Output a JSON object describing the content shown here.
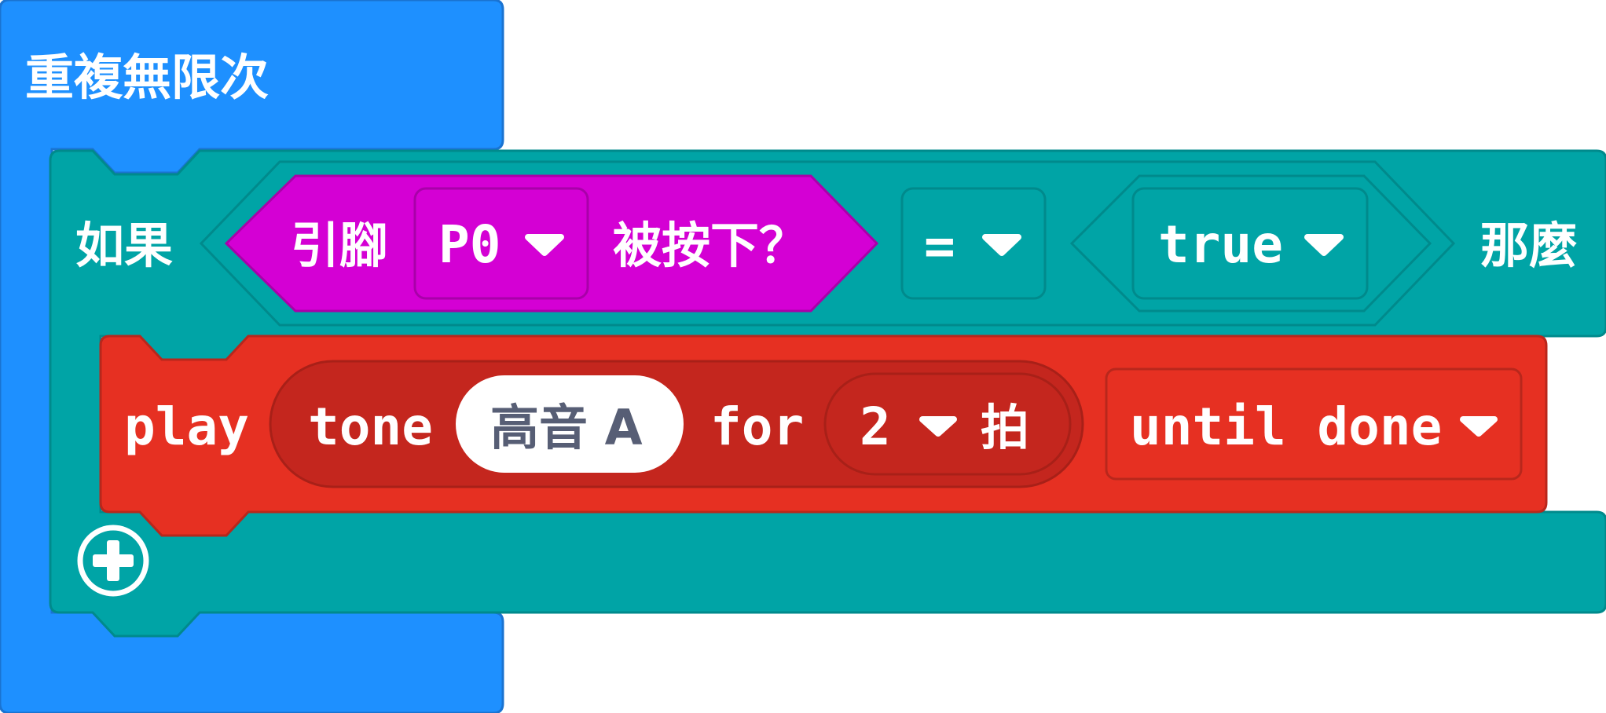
{
  "blocks": {
    "forever": {
      "label": "重複無限次",
      "color": "#1e90ff",
      "border": "#1a73d1"
    },
    "if_block": {
      "if_label": "如果",
      "then_label": "那麼",
      "color": "#00a4a6",
      "border": "#008a8c",
      "add_icon": "plus-circle-icon"
    },
    "pin_pressed": {
      "prefix": "引腳",
      "pin_value": "P0",
      "suffix": "被按下？",
      "color": "#d400d4",
      "border": "#a900a9"
    },
    "compare": {
      "operator": "=",
      "bool_value": "true"
    },
    "play_tone": {
      "play_label": "play",
      "tone_label": "tone",
      "note_value": "高音 A",
      "for_label": "for",
      "beats_value": "2",
      "beats_unit": "拍",
      "mode_value": "until done",
      "color": "#e63022",
      "inner_color": "#c4261e",
      "border": "#b8271c"
    },
    "dropdown_icon": "triangle-down-icon"
  }
}
